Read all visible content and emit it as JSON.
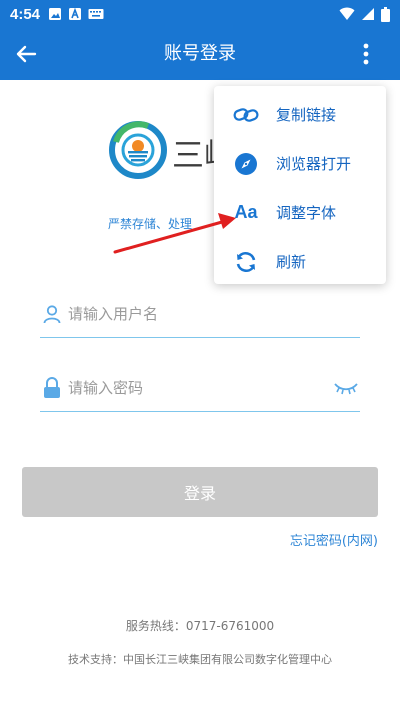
{
  "status_bar": {
    "time": "4:54",
    "icons": [
      "image-icon",
      "a-icon",
      "keyboard-icon",
      "wifi-icon",
      "signal-icon",
      "battery-icon"
    ]
  },
  "app_bar": {
    "title": "账号登录",
    "back_icon": "back-arrow-icon",
    "more_icon": "more-vert-icon"
  },
  "brand": {
    "name": "三峡",
    "subtitle": "严禁存储、处理"
  },
  "form": {
    "username_placeholder": "请输入用户名",
    "password_placeholder": "请输入密码",
    "login_label": "登录",
    "forgot_label": "忘记密码(内网)"
  },
  "footer": {
    "hotline": "服务热线：0717-6761000",
    "support": "技术支持：中国长江三峡集团有限公司数字化管理中心"
  },
  "menu": {
    "items": [
      {
        "label": "复制链接",
        "icon": "link-icon"
      },
      {
        "label": "浏览器打开",
        "icon": "compass-icon"
      },
      {
        "label": "调整字体",
        "icon": "font-size-icon",
        "glyph": "Aa"
      },
      {
        "label": "刷新",
        "icon": "refresh-icon"
      }
    ]
  },
  "colors": {
    "primary": "#1976d2",
    "accent_text": "#2f86d6",
    "annotation": "#e02020",
    "button_disabled": "#c8c8c8"
  }
}
